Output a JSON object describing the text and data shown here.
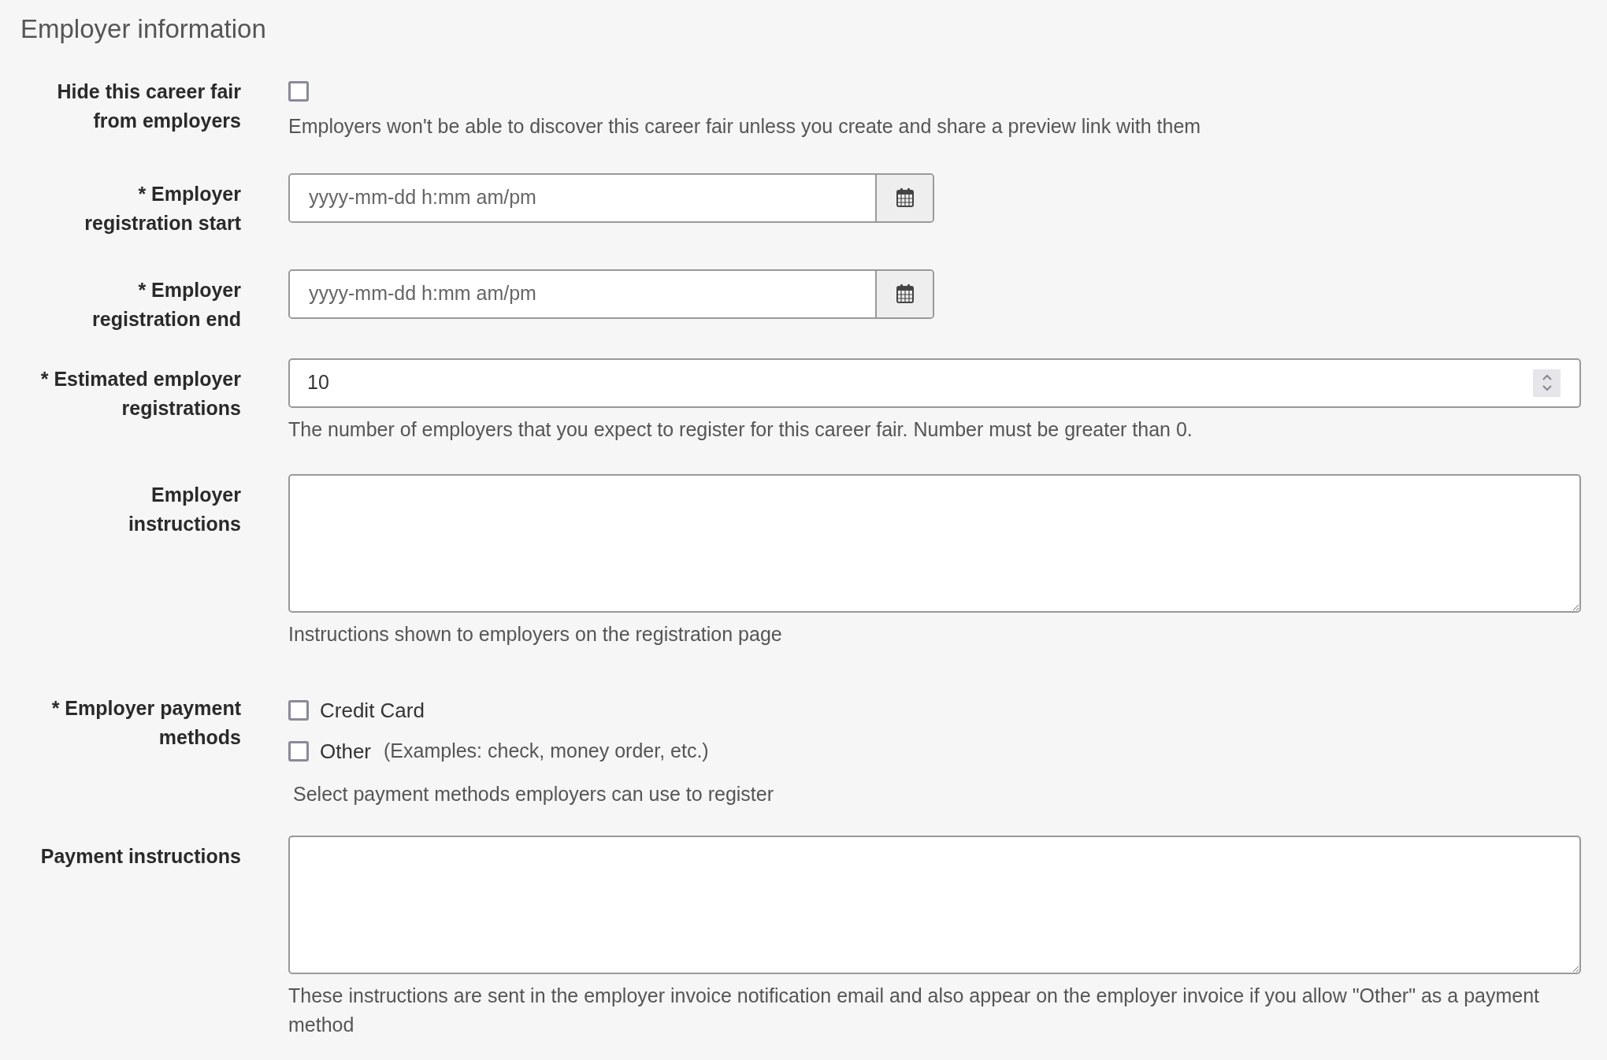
{
  "section_title": "Employer information",
  "fields": [
    {
      "kind": "checkbox",
      "label": "Hide this career fair from employers",
      "checked": false,
      "help": "Employers won't be able to discover this career fair unless you create and share a preview link with them"
    },
    {
      "kind": "datetime",
      "label": "* Employer registration start",
      "placeholder": "yyyy-mm-dd h:mm am/pm"
    },
    {
      "kind": "datetime",
      "label": "* Employer registration end",
      "placeholder": "yyyy-mm-dd h:mm am/pm"
    },
    {
      "kind": "number",
      "label": "* Estimated employer registrations",
      "value": "10",
      "help": "The number of employers that you expect to register for this career fair. Number must be greater than 0."
    },
    {
      "kind": "textarea",
      "label": "Employer instructions",
      "help": "Instructions shown to employers on the registration page"
    },
    {
      "kind": "checkbox_group",
      "label": "* Employer payment methods",
      "options": [
        {
          "label": "Credit Card",
          "checked": false
        },
        {
          "label": "Other",
          "note": "(Examples: check, money order, etc.)",
          "checked": false
        }
      ],
      "help": "Select payment methods employers can use to register"
    },
    {
      "kind": "textarea",
      "label": "Payment instructions",
      "help": "These instructions are sent in the employer invoice notification email and also appear on the employer invoice if you allow \"Other\" as a payment method"
    }
  ]
}
